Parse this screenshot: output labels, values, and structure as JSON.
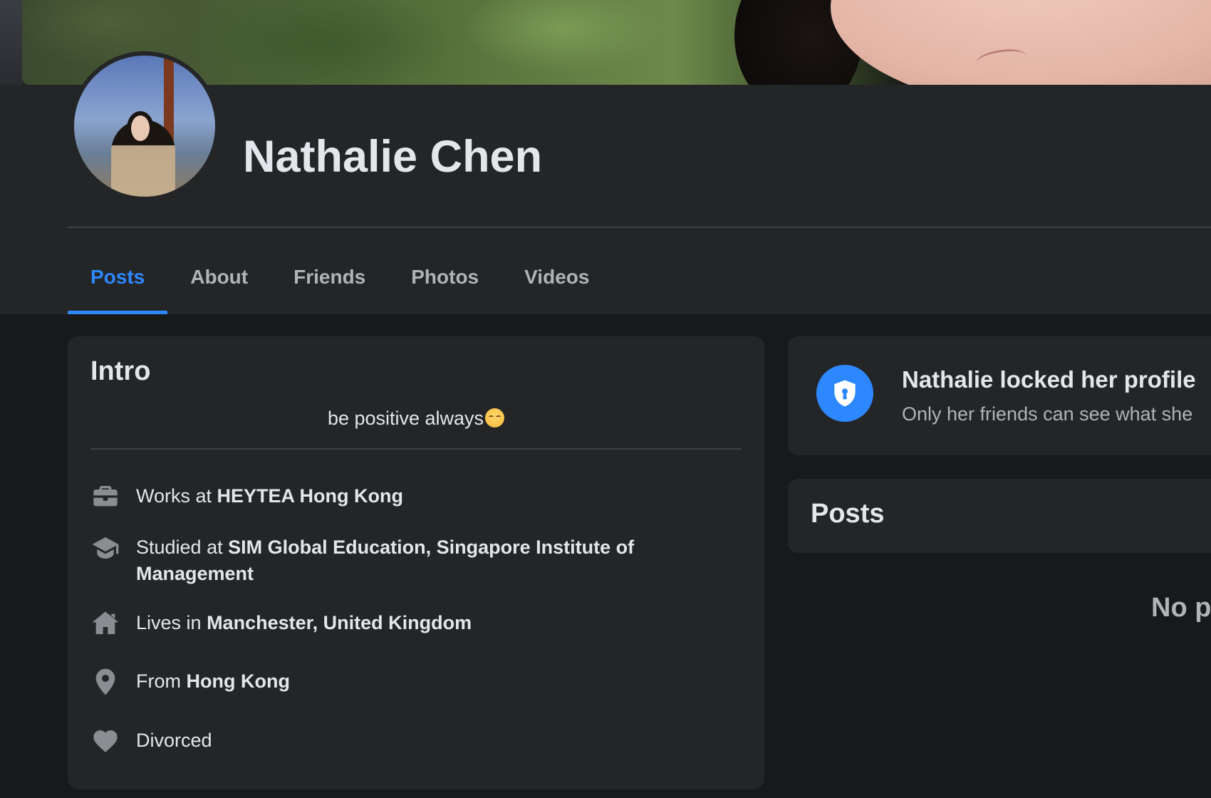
{
  "profile": {
    "name": "Nathalie Chen"
  },
  "tabs": [
    {
      "label": "Posts",
      "active": true
    },
    {
      "label": "About",
      "active": false
    },
    {
      "label": "Friends",
      "active": false
    },
    {
      "label": "Photos",
      "active": false
    },
    {
      "label": "Videos",
      "active": false
    }
  ],
  "intro": {
    "title": "Intro",
    "bio": "be positive always",
    "bio_emoji": "smiling-face-emoji",
    "items": [
      {
        "icon": "briefcase-icon",
        "prefix": "Works at ",
        "value": "HEYTEA Hong Kong"
      },
      {
        "icon": "graduation-cap-icon",
        "prefix": "Studied at ",
        "value": "SIM Global Education, Singapore Institute of Management"
      },
      {
        "icon": "home-icon",
        "prefix": "Lives in ",
        "value": "Manchester, United Kingdom"
      },
      {
        "icon": "location-pin-icon",
        "prefix": "From ",
        "value": "Hong Kong"
      },
      {
        "icon": "heart-icon",
        "prefix": "",
        "value": "Divorced"
      }
    ]
  },
  "locked": {
    "title": "Nathalie locked her profile",
    "subtitle": "Only her friends can see what she"
  },
  "posts": {
    "title": "Posts",
    "empty_text": "No p"
  },
  "colors": {
    "accent": "#2d88ff",
    "background": "#18191a",
    "card": "#242526",
    "icon": "#8a8d91",
    "text_primary": "#e4e6eb",
    "text_secondary": "#b0b3b8"
  }
}
